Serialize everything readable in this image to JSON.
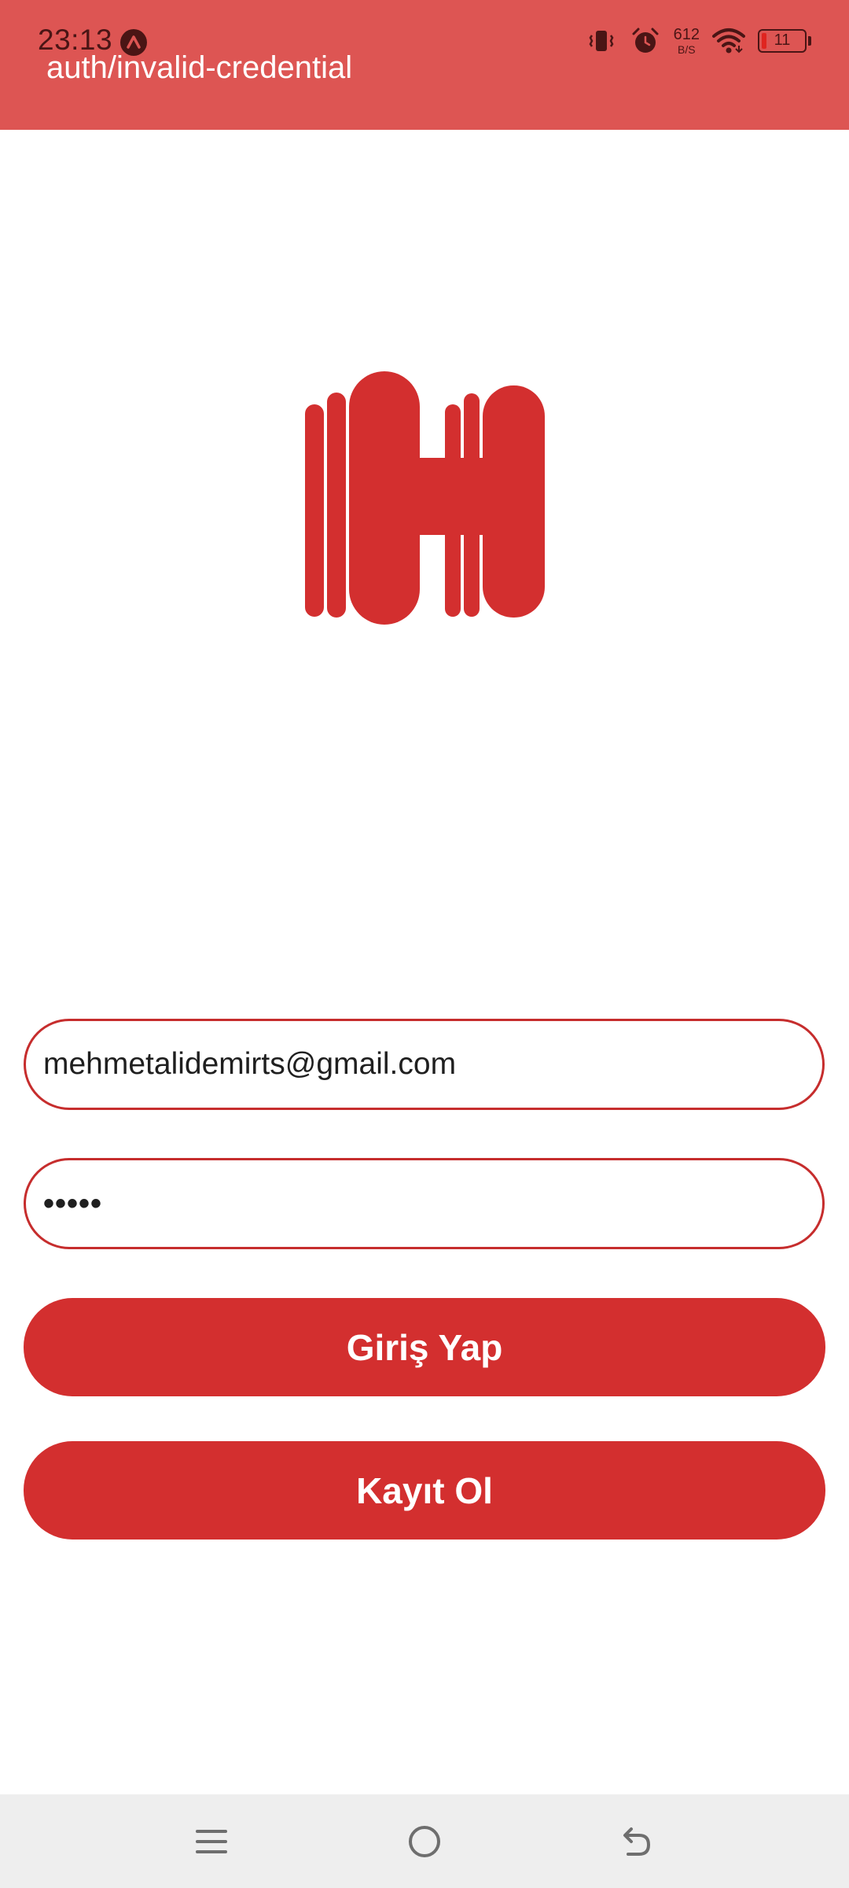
{
  "status_bar": {
    "time": "23:13",
    "network_speed_value": "612",
    "network_speed_unit": "B/S",
    "battery_level": "11",
    "icons": [
      "app-notification-icon",
      "vibrate-icon",
      "alarm-icon",
      "wifi-icon",
      "battery-icon"
    ]
  },
  "header": {
    "error_message": "auth/invalid-credential",
    "background_color": "#dd5553"
  },
  "logo": {
    "icon": "h-logo-icon",
    "color": "#d32f2f"
  },
  "form": {
    "email_value": "mehmetalidemirts@gmail.com",
    "password_value": "•••••"
  },
  "buttons": {
    "login_label": "Giriş Yap",
    "register_label": "Kayıt Ol",
    "color": "#d32f2f"
  },
  "navigation_bar": {
    "icons": [
      "menu-icon",
      "home-icon",
      "back-icon"
    ]
  }
}
